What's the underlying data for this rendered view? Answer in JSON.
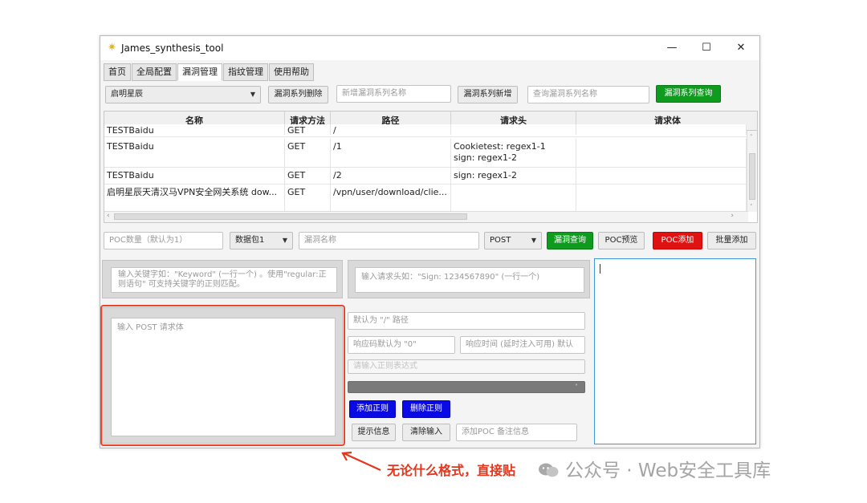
{
  "window": {
    "title": "James_synthesis_tool",
    "minimize": "—",
    "maximize": "☐",
    "close": "✕"
  },
  "tabs": [
    "首页",
    "全局配置",
    "漏洞管理",
    "指纹管理",
    "使用帮助"
  ],
  "active_tab": "漏洞管理",
  "toolbar": {
    "series_select": "启明星辰",
    "delete_series": "漏洞系列删除",
    "new_series_placeholder": "新增漏洞系列名称",
    "add_series": "漏洞系列新增",
    "query_series_placeholder": "查询漏洞系列名称",
    "query_series": "漏洞系列查询"
  },
  "table": {
    "columns": [
      "名称",
      "请求方法",
      "路径",
      "请求头",
      "请求体"
    ],
    "rows": [
      {
        "name": "TESTBaidu",
        "method": "GET",
        "path": "/",
        "header": "",
        "body": ""
      },
      {
        "name": "TESTBaidu",
        "method": "GET",
        "path": "/1",
        "header": "Cookietest: regex1-1\nsign: regex1-2",
        "body": ""
      },
      {
        "name": "TESTBaidu",
        "method": "GET",
        "path": "/2",
        "header": "sign: regex1-2",
        "body": ""
      },
      {
        "name": "启明星辰天清汉马VPN安全网关系统 dow...",
        "method": "GET",
        "path": "/vpn/user/download/clie...",
        "header": "",
        "body": ""
      }
    ]
  },
  "poc_bar": {
    "poc_count_placeholder": "POC数量（默认为1）",
    "packet_select": "数据包1",
    "vuln_name_placeholder": "漏洞名称",
    "method_select": "POST",
    "vuln_query": "漏洞查询",
    "poc_preview": "POC预览",
    "poc_add": "POC添加",
    "batch_add": "批量添加"
  },
  "keyword_placeholder": "输入关键字如：\"Keyword\" (一行一个) 。使用\"regular:正则语句\" 可支持关键字的正则匹配。",
  "header_placeholder": "输入请求头如：\"Sign: 1234567890\" (一行一个)",
  "post_body_placeholder": "输入 POST 请求体",
  "path_placeholder": "默认为 \"/\" 路径",
  "status_code_placeholder": "响应码默认为 \"0\"",
  "response_time_placeholder": "响应时间 (延时注入可用) 默认",
  "regex_placeholder": "请输入正则表达式",
  "add_regex": "添加正则",
  "delete_regex": "删除正则",
  "hint_info": "提示信息",
  "clear_input": "清除输入",
  "poc_note_placeholder": "添加POC 备注信息",
  "annotation": "无论什么格式，直接贴",
  "watermark": "公众号 · Web安全工具库",
  "colors": {
    "green_button": "#0e9b1e",
    "red_button": "#e01313",
    "blue_button": "#0a0ae6",
    "annotation_red": "#e2361d",
    "output_border": "#3a9ad9"
  }
}
